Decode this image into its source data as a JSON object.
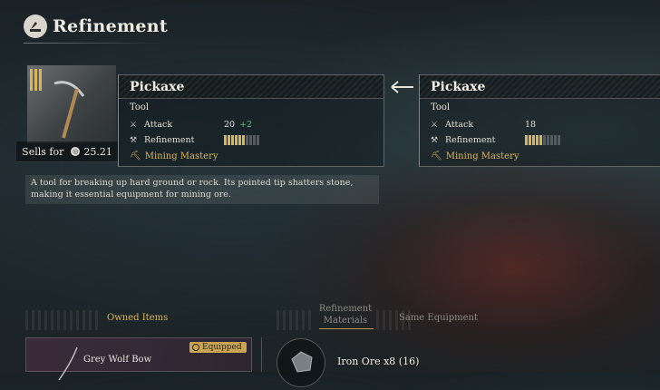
{
  "header": {
    "title": "Refinement",
    "icon": "refinement-icon"
  },
  "item": {
    "icon": "pickaxe-icon",
    "tier_bars": 3,
    "sells_for_label": "Sells for",
    "sells_for_value": "25.21"
  },
  "current": {
    "name": "Pickaxe",
    "type": "Tool",
    "attack_label": "Attack",
    "attack_value": "20",
    "attack_bonus": "+2",
    "refinement_label": "Refinement",
    "refinement_level": 6,
    "refinement_max": 10,
    "mastery_label": "Mining Mastery"
  },
  "compare": {
    "name": "Pickaxe",
    "type": "Tool",
    "attack_label": "Attack",
    "attack_value": "18",
    "refinement_label": "Refinement",
    "refinement_level": 5,
    "refinement_max": 10,
    "mastery_label": "Mining Mastery"
  },
  "description": "A tool for breaking up hard ground or rock. Its pointed tip shatters stone, making it essential equipment for mining ore.",
  "tabs": {
    "owned": "Owned Items",
    "refinement_materials": "Refinement Materials",
    "same_equipment": "Same Equipment"
  },
  "owned_items": [
    {
      "name": "Grey Wolf Bow",
      "badge": "Equipped"
    }
  ],
  "materials": [
    {
      "name": "Iron Ore x8 (16)"
    }
  ],
  "colors": {
    "accent_gold": "#d9b45a",
    "bonus_green": "#54c27a"
  }
}
